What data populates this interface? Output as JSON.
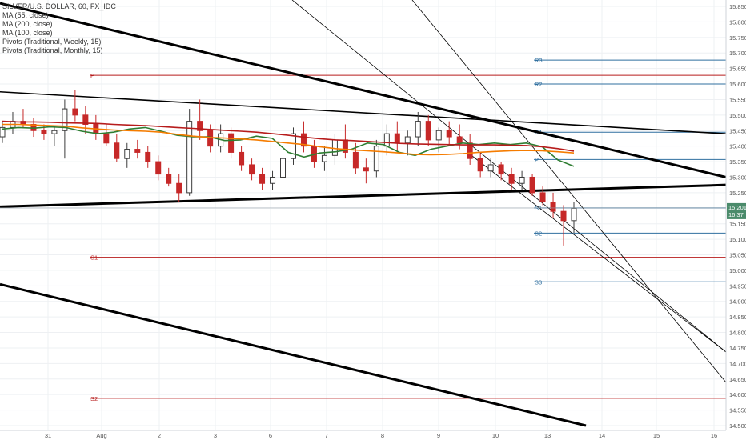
{
  "chart_data": {
    "type": "candlestick",
    "title": "SILVER/U.S. DOLLAR, 60, FX_IDC",
    "legend": [
      "MA (55, close)",
      "MA (200, close)",
      "MA (100, close)",
      "Pivots (Traditional, Weekly, 15)",
      "Pivots (Traditional, Monthly, 15)"
    ],
    "xlabel": "",
    "ylabel": "",
    "x_ticks": [
      "31",
      "Aug",
      "2",
      "3",
      "6",
      "7",
      "8",
      "9",
      "10",
      "13",
      "14",
      "15",
      "16"
    ],
    "y_ticks": [
      "15.850",
      "15.800",
      "15.750",
      "15.700",
      "15.650",
      "15.600",
      "15.550",
      "15.500",
      "15.450",
      "15.400",
      "15.350",
      "15.300",
      "15.250",
      "15.200",
      "15.150",
      "15.100",
      "15.050",
      "15.000",
      "14.950",
      "14.900",
      "14.850",
      "14.800",
      "14.750",
      "14.700",
      "14.650",
      "14.600",
      "14.550",
      "14.500"
    ],
    "ylim": [
      14.5,
      15.86
    ],
    "last_price": "15.201",
    "countdown": "16:37",
    "grid": true,
    "series_colors": {
      "ma55": "#2e7d32",
      "ma100": "#b71c1c",
      "ma200": "#f57c00",
      "up": "#3b3b3b",
      "down": "#c62828"
    },
    "pivots": [
      {
        "label": "P",
        "value": 15.628,
        "color": "#b71c1c",
        "x0": "31",
        "x1": "16"
      },
      {
        "label": "S1",
        "value": 15.042,
        "color": "#b71c1c",
        "x0": "31",
        "x1": "16"
      },
      {
        "label": "S2",
        "value": 14.588,
        "color": "#b71c1c",
        "x0": "31",
        "x1": "16"
      },
      {
        "label": "R3",
        "value": 15.677,
        "color": "#2f6f9f",
        "x0": "13",
        "x1": "16"
      },
      {
        "label": "R2",
        "value": 15.6,
        "color": "#2f6f9f",
        "x0": "13",
        "x1": "16"
      },
      {
        "label": "R1",
        "value": 15.445,
        "color": "#2f6f9f",
        "x0": "13",
        "x1": "16"
      },
      {
        "label": "P",
        "value": 15.357,
        "color": "#2f6f9f",
        "x0": "13",
        "x1": "16"
      },
      {
        "label": "S1",
        "value": 15.201,
        "color": "#2f6f9f",
        "x0": "13",
        "x1": "16"
      },
      {
        "label": "S2",
        "value": 15.12,
        "color": "#2f6f9f",
        "x0": "13",
        "x1": "16"
      },
      {
        "label": "S3",
        "value": 14.963,
        "color": "#2f6f9f",
        "x0": "13",
        "x1": "16"
      }
    ],
    "trendlines": [
      {
        "x0": "31",
        "y0": 15.575,
        "x1": "16",
        "y1": 15.44,
        "width": "thin"
      },
      {
        "x0": "31",
        "y0": 15.205,
        "x1": "16",
        "y1": 15.275,
        "width": "thick"
      },
      {
        "x0": "31",
        "y0": 15.86,
        "x1": "16",
        "y1": 15.3,
        "width": "thick"
      },
      {
        "x0": "31",
        "y0": 14.955,
        "x1": "14",
        "y1": 14.5,
        "width": "thick"
      }
    ],
    "series": [
      {
        "name": "MA (55, close)",
        "values": [
          15.455,
          15.46,
          15.458,
          15.462,
          15.46,
          15.448,
          15.44,
          15.445,
          15.455,
          15.46,
          15.448,
          15.435,
          15.43,
          15.43,
          15.418,
          15.42,
          15.432,
          15.425,
          15.38,
          15.365,
          15.378,
          15.382,
          15.39,
          15.41,
          15.405,
          15.38,
          15.37,
          15.39,
          15.4,
          15.41,
          15.405,
          15.41,
          15.405,
          15.41,
          15.398,
          15.355,
          15.335
        ]
      },
      {
        "name": "MA (200, close)",
        "values": [
          15.47,
          15.47,
          15.468,
          15.466,
          15.464,
          15.459,
          15.455,
          15.452,
          15.45,
          15.448,
          15.445,
          15.438,
          15.432,
          15.428,
          15.426,
          15.423,
          15.42,
          15.415,
          15.41,
          15.405,
          15.398,
          15.392,
          15.388,
          15.385,
          15.382,
          15.378,
          15.373,
          15.372,
          15.373,
          15.376,
          15.38,
          15.383,
          15.385,
          15.386,
          15.385,
          15.382,
          15.378
        ]
      },
      {
        "name": "MA (100, close)",
        "values": [
          15.48,
          15.478,
          15.478,
          15.477,
          15.475,
          15.474,
          15.473,
          15.47,
          15.468,
          15.466,
          15.463,
          15.46,
          15.457,
          15.454,
          15.451,
          15.448,
          15.445,
          15.44,
          15.435,
          15.429,
          15.424,
          15.42,
          15.418,
          15.415,
          15.412,
          15.409,
          15.407,
          15.406,
          15.405,
          15.404,
          15.404,
          15.404,
          15.403,
          15.402,
          15.398,
          15.392,
          15.384
        ]
      }
    ],
    "candles": [
      [
        15.43,
        15.48,
        15.41,
        15.46
      ],
      [
        15.46,
        15.51,
        15.44,
        15.48
      ],
      [
        15.48,
        15.52,
        15.46,
        15.47
      ],
      [
        15.47,
        15.49,
        15.43,
        15.45
      ],
      [
        15.45,
        15.47,
        15.42,
        15.44
      ],
      [
        15.44,
        15.46,
        15.4,
        15.45
      ],
      [
        15.45,
        15.55,
        15.36,
        15.52
      ],
      [
        15.52,
        15.58,
        15.48,
        15.5
      ],
      [
        15.5,
        15.53,
        15.44,
        15.47
      ],
      [
        15.47,
        15.5,
        15.42,
        15.44
      ],
      [
        15.44,
        15.47,
        15.4,
        15.41
      ],
      [
        15.41,
        15.44,
        15.35,
        15.36
      ],
      [
        15.36,
        15.41,
        15.33,
        15.39
      ],
      [
        15.39,
        15.42,
        15.36,
        15.38
      ],
      [
        15.38,
        15.4,
        15.33,
        15.35
      ],
      [
        15.35,
        15.37,
        15.29,
        15.31
      ],
      [
        15.31,
        15.33,
        15.27,
        15.28
      ],
      [
        15.28,
        15.31,
        15.22,
        15.25
      ],
      [
        15.25,
        15.52,
        15.24,
        15.48
      ],
      [
        15.48,
        15.55,
        15.42,
        15.45
      ],
      [
        15.45,
        15.47,
        15.38,
        15.4
      ],
      [
        15.4,
        15.47,
        15.38,
        15.44
      ],
      [
        15.44,
        15.46,
        15.36,
        15.38
      ],
      [
        15.38,
        15.4,
        15.32,
        15.34
      ],
      [
        15.34,
        15.36,
        15.29,
        15.31
      ],
      [
        15.31,
        15.33,
        15.26,
        15.28
      ],
      [
        15.28,
        15.32,
        15.26,
        15.3
      ],
      [
        15.3,
        15.38,
        15.28,
        15.36
      ],
      [
        15.36,
        15.46,
        15.34,
        15.44
      ],
      [
        15.44,
        15.48,
        15.38,
        15.4
      ],
      [
        15.4,
        15.42,
        15.33,
        15.35
      ],
      [
        15.35,
        15.4,
        15.32,
        15.37
      ],
      [
        15.37,
        15.44,
        15.34,
        15.42
      ],
      [
        15.42,
        15.47,
        15.36,
        15.38
      ],
      [
        15.38,
        15.41,
        15.31,
        15.33
      ],
      [
        15.33,
        15.36,
        15.28,
        15.32
      ],
      [
        15.32,
        15.42,
        15.3,
        15.4
      ],
      [
        15.4,
        15.47,
        15.37,
        15.44
      ],
      [
        15.44,
        15.48,
        15.38,
        15.41
      ],
      [
        15.41,
        15.45,
        15.37,
        15.43
      ],
      [
        15.43,
        15.51,
        15.4,
        15.48
      ],
      [
        15.48,
        15.5,
        15.4,
        15.42
      ],
      [
        15.42,
        15.46,
        15.38,
        15.45
      ],
      [
        15.45,
        15.48,
        15.4,
        15.43
      ],
      [
        15.43,
        15.47,
        15.39,
        15.41
      ],
      [
        15.41,
        15.44,
        15.34,
        15.36
      ],
      [
        15.36,
        15.38,
        15.3,
        15.32
      ],
      [
        15.32,
        15.36,
        15.3,
        15.34
      ],
      [
        15.34,
        15.35,
        15.29,
        15.31
      ],
      [
        15.31,
        15.33,
        15.26,
        15.28
      ],
      [
        15.28,
        15.32,
        15.26,
        15.3
      ],
      [
        15.3,
        15.31,
        15.24,
        15.25
      ],
      [
        15.25,
        15.27,
        15.21,
        15.22
      ],
      [
        15.22,
        15.25,
        15.17,
        15.19
      ],
      [
        15.19,
        15.21,
        15.08,
        15.16
      ],
      [
        15.16,
        15.22,
        15.12,
        15.2
      ]
    ]
  }
}
